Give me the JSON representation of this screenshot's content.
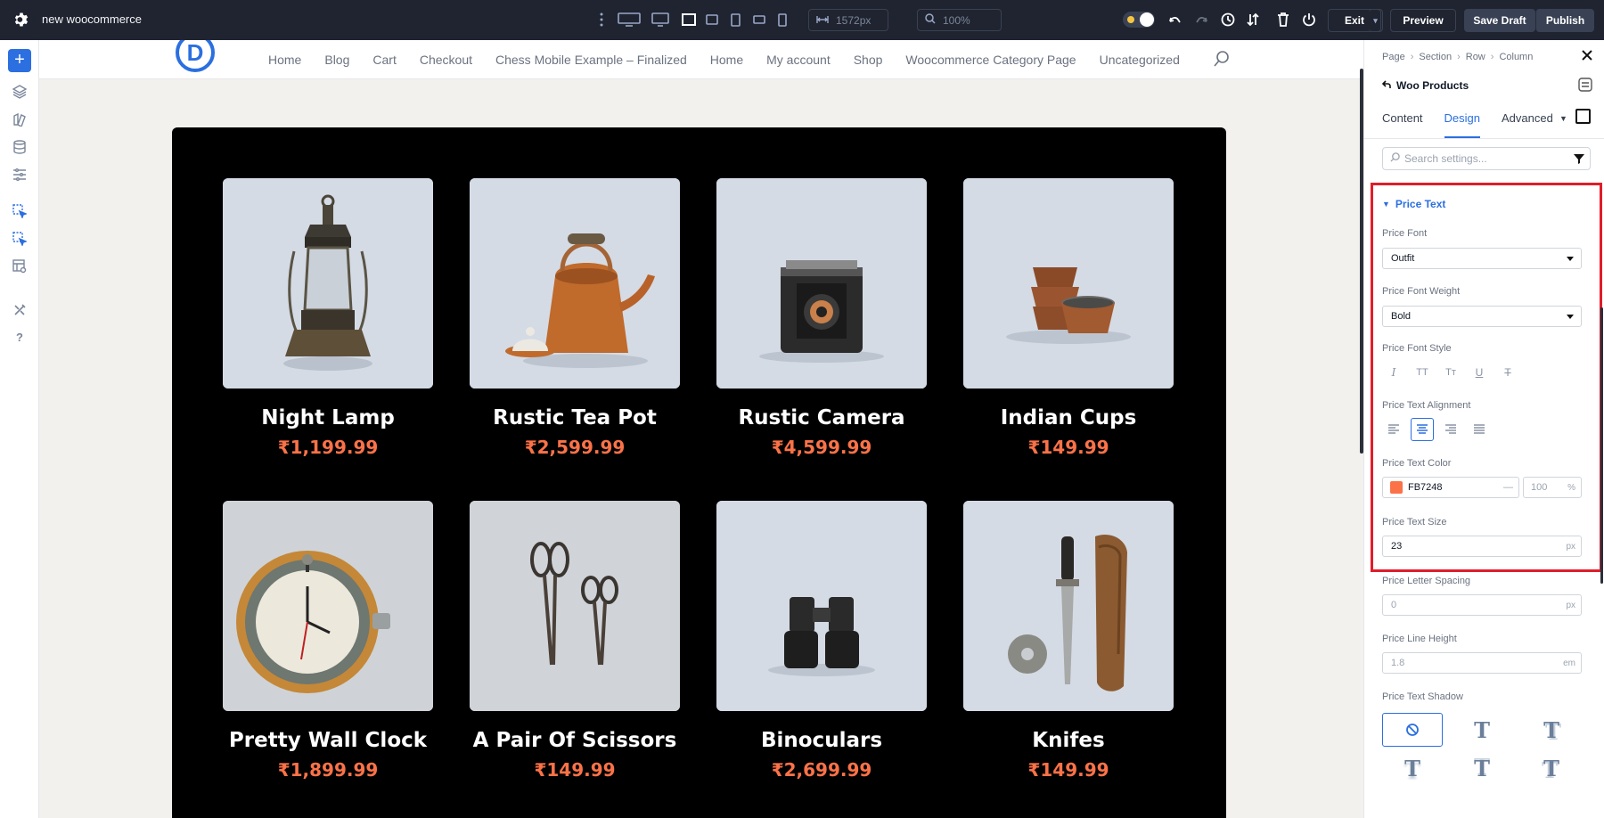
{
  "topbar": {
    "site_name": "new woocommerce",
    "width_value": "1572px",
    "zoom_value": "100%",
    "exit_label": "Exit",
    "preview_label": "Preview",
    "save_draft_label": "Save Draft",
    "publish_label": "Publish"
  },
  "site": {
    "logo_letter": "D",
    "nav": [
      "Home",
      "Blog",
      "Cart",
      "Checkout",
      "Chess Mobile Example – Finalized",
      "Home",
      "My account",
      "Shop",
      "Woocommerce Category Page",
      "Uncategorized"
    ]
  },
  "products": [
    {
      "name": "Night Lamp",
      "price": "₹1,199.99",
      "image": "lantern"
    },
    {
      "name": "Rustic Tea Pot",
      "price": "₹2,599.99",
      "image": "kettle"
    },
    {
      "name": "Rustic Camera",
      "price": "₹4,599.99",
      "image": "camera"
    },
    {
      "name": "Indian Cups",
      "price": "₹149.99",
      "image": "cups"
    },
    {
      "name": "Pretty Wall Clock",
      "price": "₹1,899.99",
      "image": "clock"
    },
    {
      "name": "A Pair Of Scissors",
      "price": "₹149.99",
      "image": "scissors"
    },
    {
      "name": "Binoculars",
      "price": "₹2,699.99",
      "image": "binoculars"
    },
    {
      "name": "Knifes",
      "price": "₹149.99",
      "image": "knife"
    }
  ],
  "panel": {
    "breadcrumb": [
      "Page",
      "Section",
      "Row",
      "Column"
    ],
    "module_title": "Woo Products",
    "tabs": [
      "Content",
      "Design",
      "Advanced"
    ],
    "active_tab": "Design",
    "search_placeholder": "Search settings...",
    "section_title": "Price Text",
    "price_font_label": "Price Font",
    "price_font_value": "Outfit",
    "price_font_weight_label": "Price Font Weight",
    "price_font_weight_value": "Bold",
    "price_font_style_label": "Price Font Style",
    "price_text_alignment_label": "Price Text Alignment",
    "price_text_color_label": "Price Text Color",
    "price_text_color_value": "FB7248",
    "price_text_color_opacity_placeholder": "100",
    "price_text_color_opacity_unit": "%",
    "price_text_size_label": "Price Text Size",
    "price_text_size_value": "23",
    "price_text_size_unit": "px",
    "price_letter_spacing_label": "Price Letter Spacing",
    "price_letter_spacing_placeholder": "0",
    "price_letter_spacing_unit": "px",
    "price_line_height_label": "Price Line Height",
    "price_line_height_placeholder": "1.8",
    "price_line_height_unit": "em",
    "price_text_shadow_label": "Price Text Shadow"
  },
  "colors": {
    "accent": "#2b6fe0",
    "price": "#FB7248",
    "highlight": "#e11d2a",
    "topbar": "#1f2430"
  }
}
